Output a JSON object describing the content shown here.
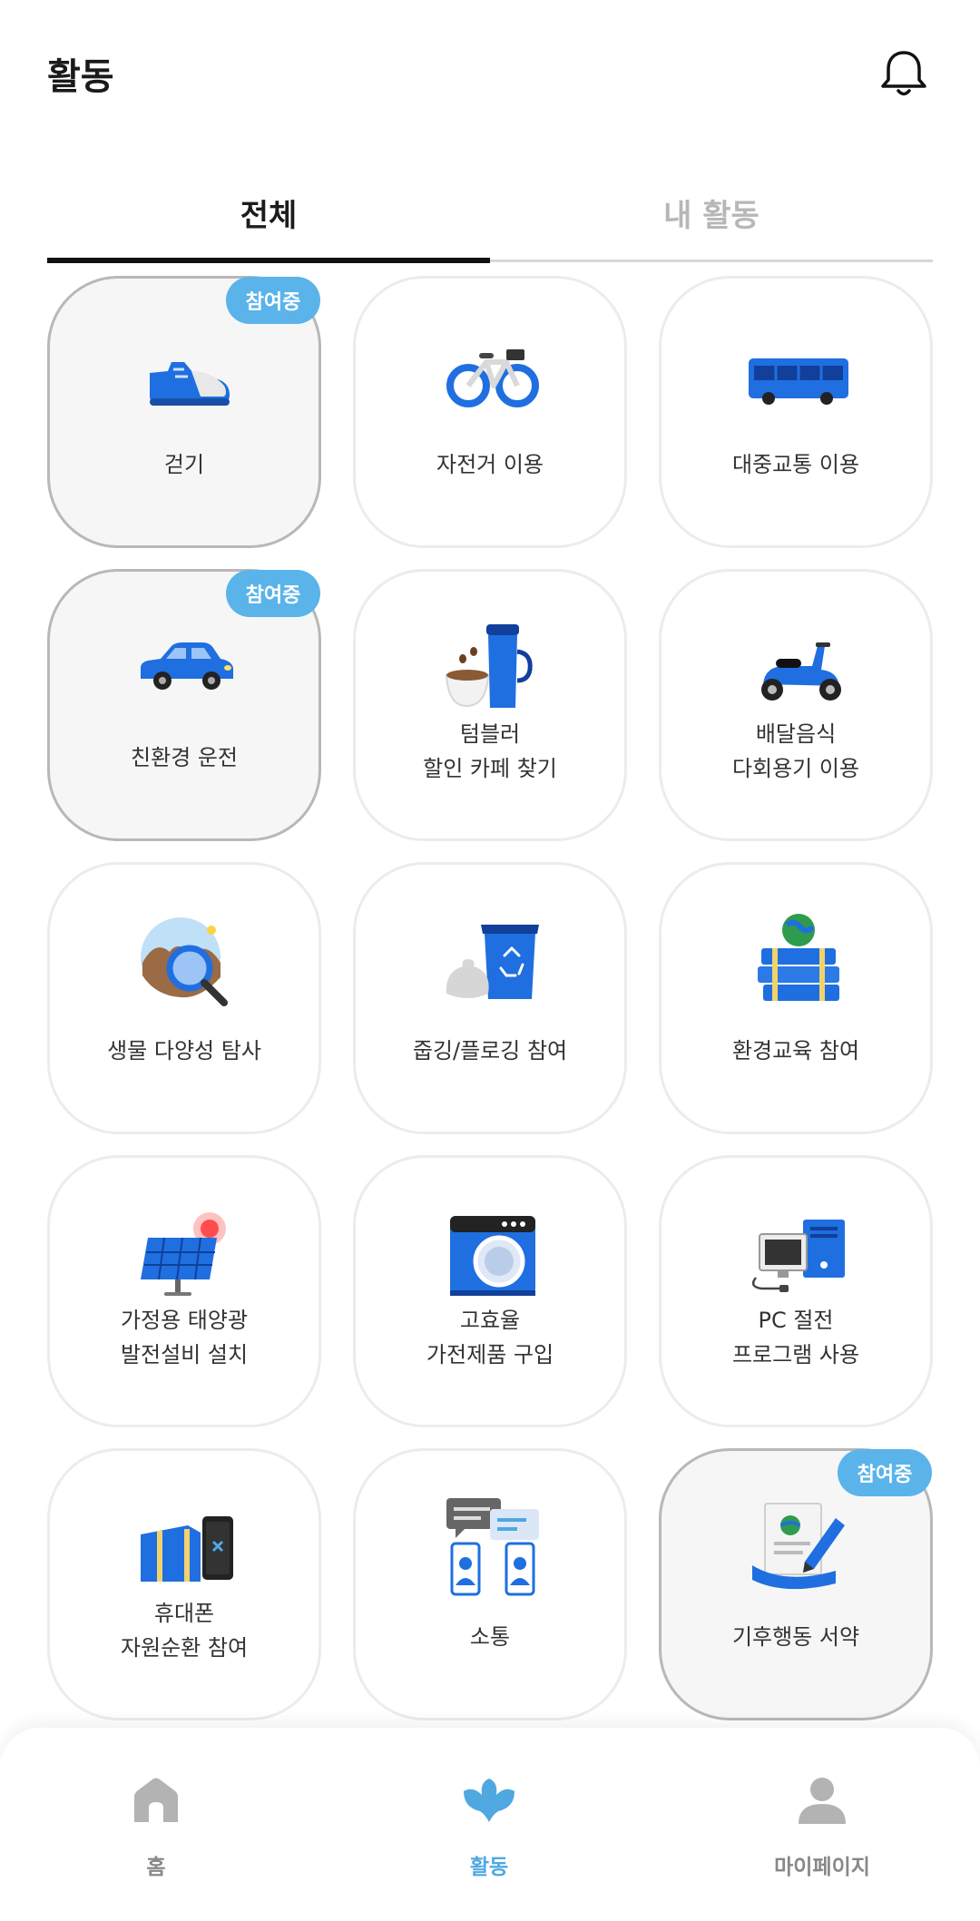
{
  "header": {
    "title": "활동"
  },
  "tabs": [
    {
      "label": "전체",
      "active": true
    },
    {
      "label": "내 활동",
      "active": false
    }
  ],
  "badge_label": "참여중",
  "colors": {
    "accent": "#5ab4ea",
    "icon_blue": "#1f6fe0",
    "active_tab_line": "#111111",
    "inactive_text": "#b7b7b7"
  },
  "activities": [
    {
      "lines": [
        "걷기"
      ],
      "participating": true,
      "icon": "sneaker-icon"
    },
    {
      "lines": [
        "자전거 이용"
      ],
      "participating": false,
      "icon": "bicycle-icon"
    },
    {
      "lines": [
        "대중교통 이용"
      ],
      "participating": false,
      "icon": "bus-icon"
    },
    {
      "lines": [
        "친환경 운전"
      ],
      "participating": true,
      "icon": "car-icon"
    },
    {
      "lines": [
        "텀블러",
        "할인 카페 찾기"
      ],
      "participating": false,
      "icon": "tumbler-icon"
    },
    {
      "lines": [
        "배달음식",
        "다회용기 이용"
      ],
      "participating": false,
      "icon": "scooter-icon"
    },
    {
      "lines": [
        "생물 다양성 탐사"
      ],
      "participating": false,
      "icon": "magnifier-globe-icon"
    },
    {
      "lines": [
        "줍깅/플로깅 참여"
      ],
      "participating": false,
      "icon": "recycle-bin-icon"
    },
    {
      "lines": [
        "환경교육 참여"
      ],
      "participating": false,
      "icon": "books-globe-icon"
    },
    {
      "lines": [
        "가정용 태양광",
        "발전설비 설치"
      ],
      "participating": false,
      "icon": "solar-panel-icon"
    },
    {
      "lines": [
        "고효율",
        "가전제품 구입"
      ],
      "participating": false,
      "icon": "washing-machine-icon"
    },
    {
      "lines": [
        "PC 절전",
        "프로그램 사용"
      ],
      "participating": false,
      "icon": "computer-icon"
    },
    {
      "lines": [
        "휴대폰",
        "자원순환 참여"
      ],
      "participating": false,
      "icon": "phone-box-icon"
    },
    {
      "lines": [
        "소통"
      ],
      "participating": false,
      "icon": "chat-users-icon"
    },
    {
      "lines": [
        "기후행동 서약"
      ],
      "participating": true,
      "icon": "pledge-document-icon"
    }
  ],
  "bottom_nav": [
    {
      "label": "홈",
      "icon": "home-icon",
      "active": false
    },
    {
      "label": "활동",
      "icon": "activity-leaf-icon",
      "active": true
    },
    {
      "label": "마이페이지",
      "icon": "person-icon",
      "active": false
    }
  ]
}
